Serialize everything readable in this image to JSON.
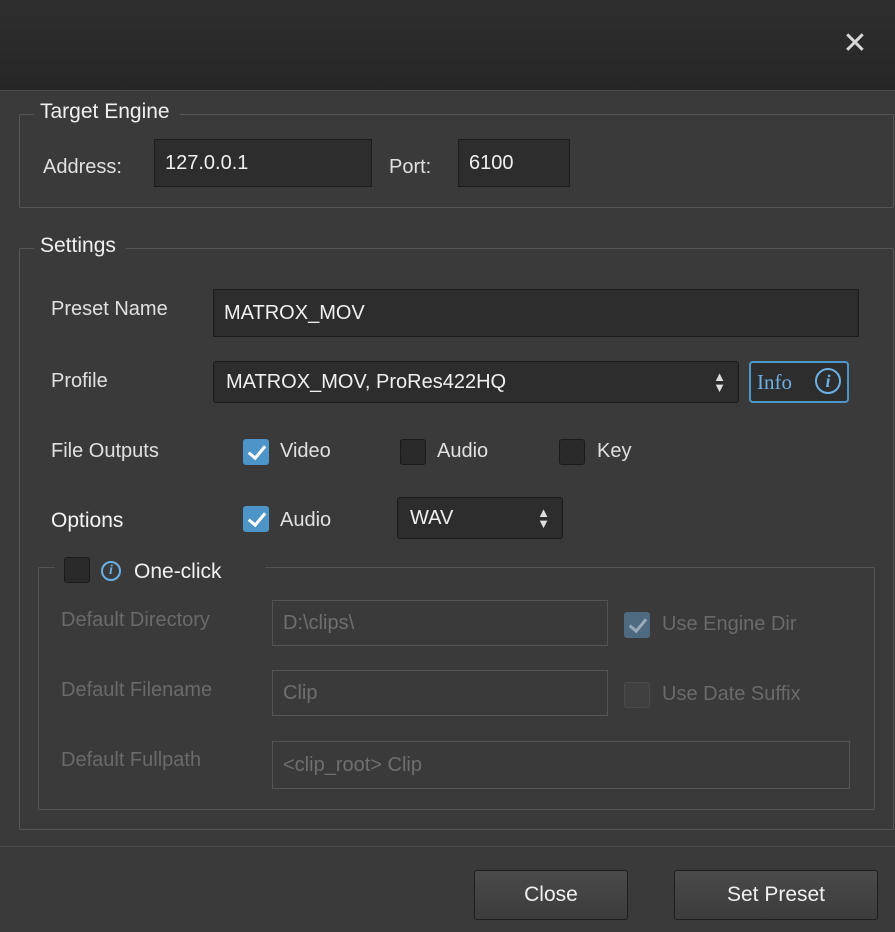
{
  "window": {
    "close_glyph": "✕"
  },
  "target_engine": {
    "title": "Target Engine",
    "address_label": "Address:",
    "address_value": "127.0.0.1",
    "port_label": "Port:",
    "port_value": "6100"
  },
  "settings": {
    "title": "Settings",
    "preset_name_label": "Preset Name",
    "preset_name_value": "MATROX_MOV",
    "profile_label": "Profile",
    "profile_value": "MATROX_MOV, ProRes422HQ",
    "info_label": "Info",
    "info_glyph": "i",
    "file_outputs_label": "File Outputs",
    "file_outputs": [
      {
        "label": "Video",
        "checked": true
      },
      {
        "label": "Audio",
        "checked": false
      },
      {
        "label": "Key",
        "checked": false
      }
    ],
    "options_label": "Options",
    "options_audio_label": "Audio",
    "options_audio_checked": true,
    "audio_format_value": "WAV"
  },
  "one_click": {
    "title": "One-click",
    "enabled": false,
    "default_directory_label": "Default Directory",
    "default_directory_value": "D:\\clips\\",
    "use_engine_dir_label": "Use Engine Dir",
    "use_engine_dir_checked": true,
    "default_filename_label": "Default Filename",
    "default_filename_value": "Clip",
    "use_date_suffix_label": "Use Date Suffix",
    "use_date_suffix_checked": false,
    "default_fullpath_label": "Default Fullpath",
    "default_fullpath_value": "<clip_root> Clip"
  },
  "footer": {
    "close_label": "Close",
    "set_preset_label": "Set Preset"
  },
  "colors": {
    "accent": "#4d95c9",
    "background": "#3a3a3a",
    "field": "#2d2d2d"
  }
}
